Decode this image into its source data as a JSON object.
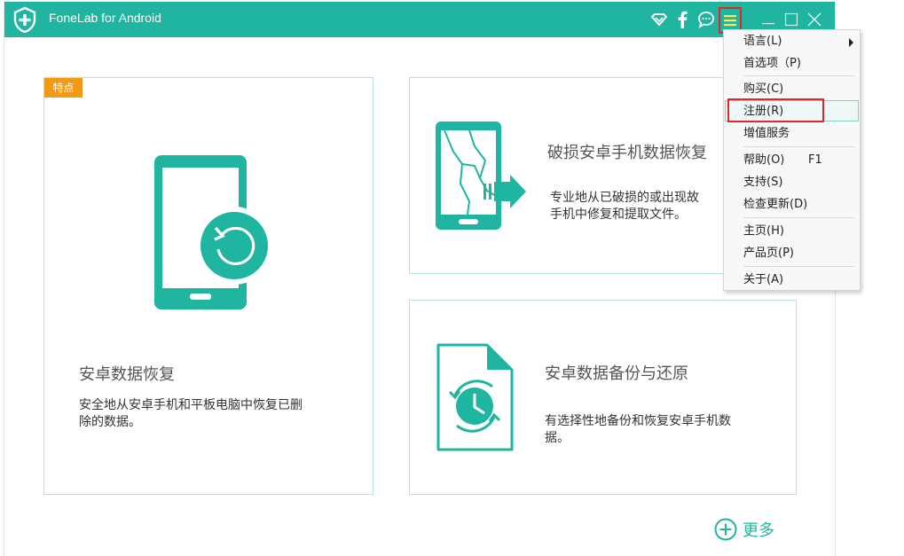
{
  "window": {
    "title": "FoneLab for Android",
    "accent_color": "#1fb5a0",
    "controls": {
      "minimize_icon": "minimize-icon",
      "maximize_icon": "maximize-icon",
      "close_icon": "close-icon"
    }
  },
  "toolbar": {
    "icons": [
      "wifi-icon",
      "facebook-icon",
      "chat-icon",
      "menu-icon"
    ],
    "menu_highlight_color": "#e1262c"
  },
  "features": {
    "tag": "特点",
    "tag_color": "#f29a13",
    "android_recovery": {
      "title": "安卓数据恢复",
      "desc_line1": "安全地从安卓手机和平板电脑中恢复已删",
      "desc_line2": "除的数据。",
      "icon": "phone-restore-icon"
    },
    "broken_recovery": {
      "title": "破损安卓手机数据恢复",
      "desc_line1": "专业地从已破损的或出现故",
      "desc_line2": "手机中修复和提取文件。",
      "icon": "broken-phone-icon"
    },
    "backup_restore": {
      "title": "安卓数据备份与还原",
      "desc_line1": "有选择性地备份和恢复安卓手机数",
      "desc_line2": "据。",
      "icon": "backup-clock-icon"
    }
  },
  "more": {
    "label": "更多",
    "icon": "plus-circle-icon"
  },
  "menu": {
    "items": [
      {
        "label": "语言(L)",
        "has_submenu": true
      },
      {
        "label": "首选项（P)"
      },
      {
        "label": "购买(C)"
      },
      {
        "label": "注册(R)",
        "highlighted": true
      },
      {
        "label": "增值服务"
      },
      {
        "label": "帮助(O)",
        "shortcut": "F1"
      },
      {
        "label": "支持(S)"
      },
      {
        "label": "检查更新(D)"
      },
      {
        "label": "主页(H)"
      },
      {
        "label": "产品页(P)"
      },
      {
        "label": "关于(A)"
      }
    ]
  }
}
